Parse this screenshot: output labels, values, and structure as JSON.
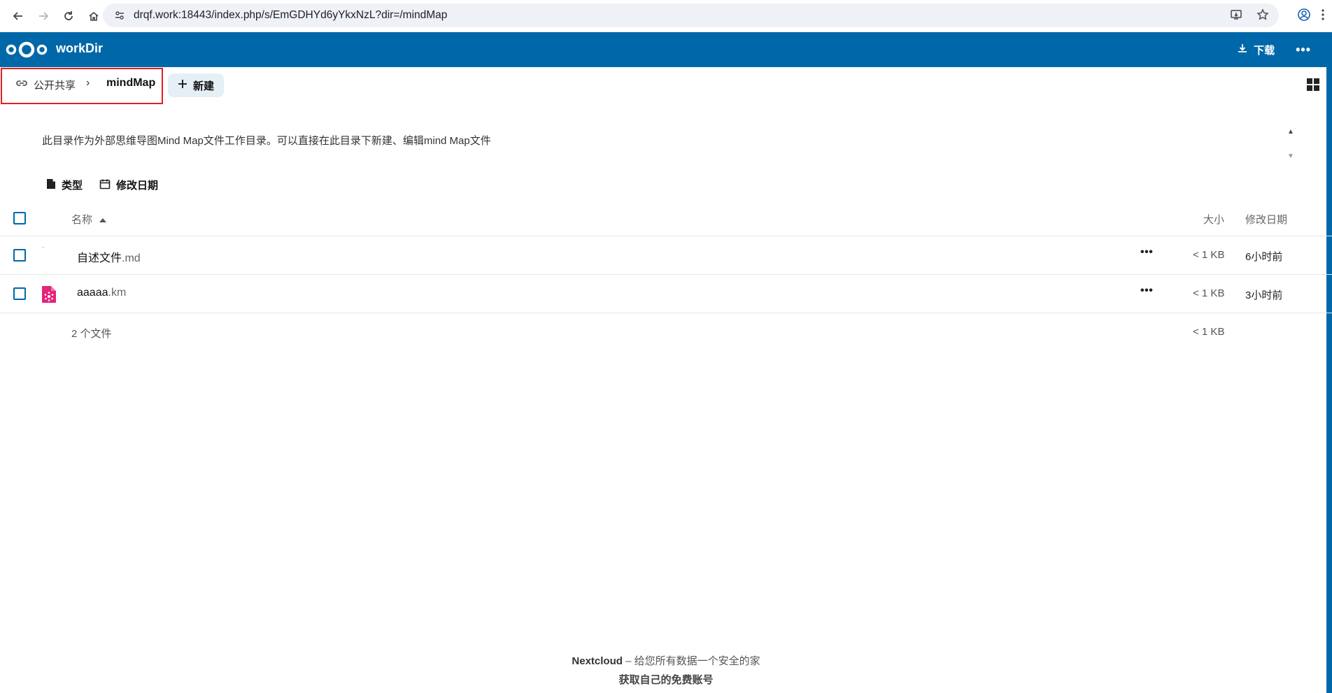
{
  "browser": {
    "url": "drqf.work:18443/index.php/s/EmGDHYd6yYkxNzL?dir=/mindMap"
  },
  "header": {
    "app_name": "workDir",
    "download_label": "下载",
    "more_label": "•••",
    "accent_color": "#0068a8"
  },
  "breadcrumb": {
    "root_label": "公开共享",
    "separator": "›",
    "current_label": "mindMap"
  },
  "new_button_label": "新建",
  "description": "此目录作为外部思维导图Mind Map文件工作目录。可以直接在此目录下新建、编辑mind Map文件",
  "filters": {
    "type_label": "类型",
    "date_label": "修改日期"
  },
  "table": {
    "col_name": "名称",
    "col_size": "大小",
    "col_modified": "修改日期",
    "rows": [
      {
        "basename": "自述文件",
        "ext": ".md",
        "size": "< 1 KB",
        "modified": "6小时前",
        "icon": "markdown-file-icon",
        "actions": "•••"
      },
      {
        "basename": "aaaaa",
        "ext": ".km",
        "size": "< 1 KB",
        "modified": "3小时前",
        "icon": "mindmap-file-icon",
        "actions": "•••"
      }
    ],
    "summary_count": "2 个文件",
    "summary_size": "< 1 KB"
  },
  "footer": {
    "brand": "Nextcloud",
    "tagline": " – 给您所有数据一个安全的家",
    "signup_link": "获取自己的免费账号"
  }
}
